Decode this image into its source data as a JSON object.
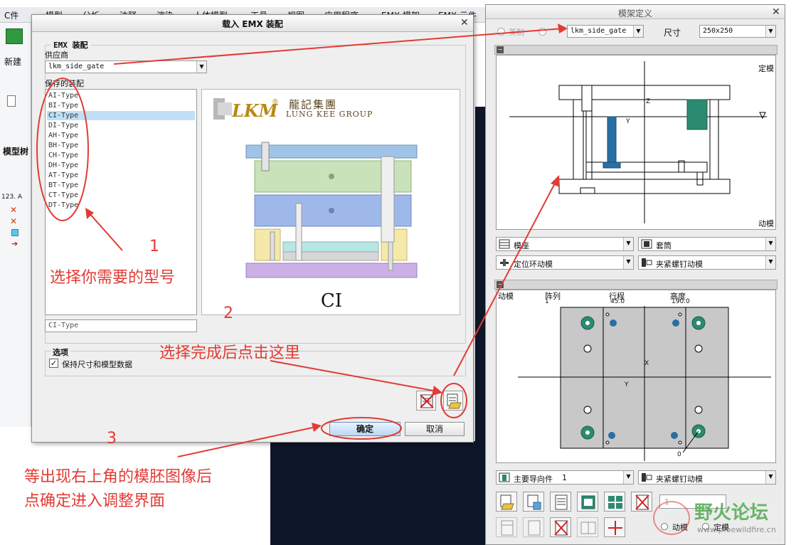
{
  "background_app": {
    "menus": [
      "C件",
      "模型",
      "分析",
      "注释",
      "渲染",
      "人体模型",
      "工具",
      "视图",
      "应用程序",
      "EMX 模架",
      "EMX 元件"
    ],
    "tree_root": "123. A",
    "side_label_create": "新建",
    "side_label_tree": "模型树"
  },
  "dialog_assembly": {
    "title": "载入 EMX 装配",
    "group_label": "EMX 装配",
    "supplier_label": "供应商",
    "supplier_value": "lkm_side_gate",
    "saved_label": "保存的装配",
    "assemblies": [
      "AI-Type",
      "BI-Type",
      "CI-Type",
      "DI-Type",
      "AH-Type",
      "BH-Type",
      "CH-Type",
      "DH-Type",
      "AT-Type",
      "BT-Type",
      "CT-Type",
      "DT-Type"
    ],
    "selected_index": 2,
    "name_field_value": "CI-Type",
    "preview_logo": "LKM",
    "preview_company_cn": "龍記集團",
    "preview_company_en": "LUNG KEE GROUP",
    "preview_caption": "CI",
    "options_label": "选项",
    "keep_checkbox_label": "保持尺寸和模型数据",
    "keep_checked": true,
    "ok_label": "确定",
    "cancel_label": "取消"
  },
  "dialog_moldbase": {
    "title": "模架定义",
    "radio_label": "英制",
    "type_value": "lkm_side_gate",
    "size_label": "尺寸",
    "size_value": "250x250",
    "view1_label_top": "定模",
    "view1_label_bottom": "动模",
    "view1_axis_z": "Z",
    "view1_axis_y": "Y",
    "combos_row1": [
      "模座",
      "套筒"
    ],
    "combos_row2": [
      "定位环动模",
      "夹紧螺钉动模"
    ],
    "view2_header": [
      "动模",
      "阵列",
      "行程",
      "高度"
    ],
    "view2_header_values": [
      "1",
      "45.0",
      "190.0"
    ],
    "view2_axis_x": "X",
    "view2_axis_y": "Y",
    "view2_point_label": "0",
    "combo_guide": "主要导向件",
    "combo_guide_count": "1",
    "combo_bolt": "夹紧螺钉动模",
    "spinner_value": "1",
    "bottom_label_moving": "动模",
    "bottom_label_fixed": "定模"
  },
  "annotations": {
    "step1_number": "1",
    "step1_text": "选择你需要的型号",
    "step2_number": "2",
    "step2_text": "选择完成后点击这里",
    "step3_number": "3",
    "step3_text_line1": "等出现右上角的模胚图像后",
    "step3_text_line2": "点确定进入调整界面"
  },
  "watermark": {
    "brand": "野火论坛",
    "url": "www.proewildfire.cn"
  },
  "colors": {
    "annotation_red": "#e23b35",
    "selected_row": "#bfe0f5",
    "dark_workspace": "#0e1629"
  }
}
